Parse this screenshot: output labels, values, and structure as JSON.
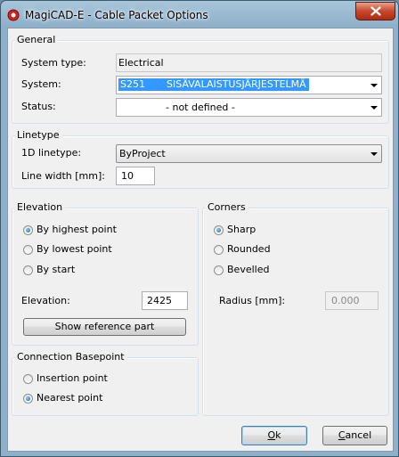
{
  "window": {
    "title": "MagiCAD-E - Cable Packet Options"
  },
  "general": {
    "legend": "General",
    "system_type_label": "System type:",
    "system_type_value": "Electrical",
    "system_label": "System:",
    "system_code": "S251",
    "system_name": "SISÄVALAISTUSJÄRJESTELMÄ",
    "status_label": "Status:",
    "status_value": "- not defined -"
  },
  "linetype": {
    "legend": "Linetype",
    "linetype_label": "1D linetype:",
    "linetype_value": "ByProject",
    "line_width_label": "Line width [mm]:",
    "line_width_value": "10"
  },
  "elevation": {
    "legend": "Elevation",
    "options": [
      "By highest point",
      "By lowest point",
      "By start"
    ],
    "selected": "By highest point",
    "elevation_label": "Elevation:",
    "elevation_value": "2425",
    "show_reference_label": "Show reference part"
  },
  "corners": {
    "legend": "Corners",
    "options": [
      "Sharp",
      "Rounded",
      "Bevelled"
    ],
    "selected": "Sharp",
    "radius_label": "Radius [mm]:",
    "radius_value": "0.000"
  },
  "basepoint": {
    "legend": "Connection Basepoint",
    "options": [
      "Insertion point",
      "Nearest point"
    ],
    "selected": "Nearest point"
  },
  "buttons": {
    "ok_mnemonic": "O",
    "ok_rest": "k",
    "cancel_mnemonic": "C",
    "cancel_rest": "ancel"
  }
}
